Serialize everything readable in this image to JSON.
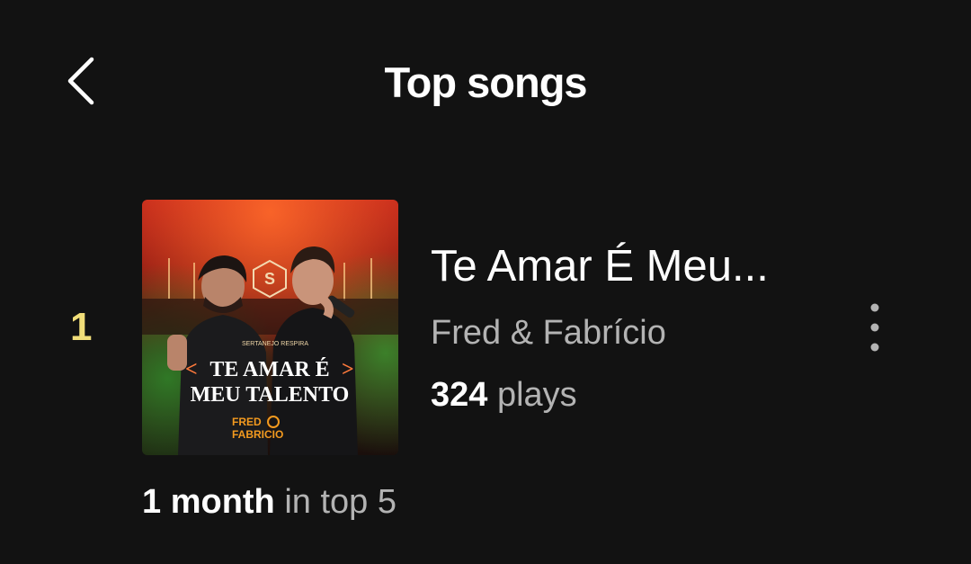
{
  "header": {
    "title": "Top songs",
    "back_icon": "chevron-left-icon"
  },
  "track": {
    "rank": "1",
    "title": "Te Amar É Meu...",
    "artist": "Fred & Fabrício",
    "plays_count": "324",
    "plays_unit": "plays",
    "more_icon": "more-vertical-icon",
    "cover": {
      "eyebrow": "SERTANEJO RESPIRA",
      "line1": "TE AMAR É",
      "line2": "MEU TALENTO",
      "artist_logo_1": "FRED",
      "artist_logo_2": "FABRICIO"
    }
  },
  "footer": {
    "duration": "1 month",
    "suffix": "in top 5"
  },
  "colors": {
    "background": "#121212",
    "rank": "#f1de79",
    "secondary_text": "#b3b3b3"
  }
}
